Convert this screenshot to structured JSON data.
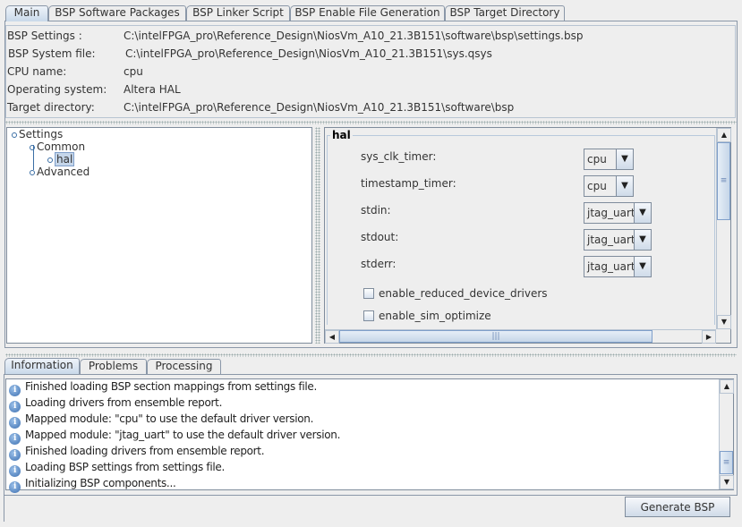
{
  "tabs": [
    "Main",
    "BSP Software Packages",
    "BSP Linker Script",
    "BSP Enable File Generation",
    "BSP Target Directory"
  ],
  "info": [
    {
      "label": "BSP Settings :",
      "value": "C:\\intelFPGA_pro\\Reference_Design\\NiosVm_A10_21.3B151\\software\\bsp\\settings.bsp"
    },
    {
      "label": "BSP System file:",
      "value": "C:\\intelFPGA_pro\\Reference_Design\\NiosVm_A10_21.3B151\\sys.qsys"
    },
    {
      "label": "CPU name:",
      "value": "cpu"
    },
    {
      "label": "Operating system:",
      "value": "Altera HAL"
    },
    {
      "label": "Target directory:",
      "value": "C:\\intelFPGA_pro\\Reference_Design\\NiosVm_A10_21.3B151\\software\\bsp"
    }
  ],
  "tree": {
    "root": "Settings",
    "common": "Common",
    "hal": "hal",
    "advanced": "Advanced"
  },
  "hal": {
    "title": "hal",
    "settings": [
      {
        "label": "sys_clk_timer:",
        "value": "cpu"
      },
      {
        "label": "timestamp_timer:",
        "value": "cpu"
      },
      {
        "label": "stdin:",
        "value": "jtag_uart"
      },
      {
        "label": "stdout:",
        "value": "jtag_uart"
      },
      {
        "label": "stderr:",
        "value": "jtag_uart"
      }
    ],
    "checkboxes": [
      {
        "label": "enable_reduced_device_drivers",
        "checked": false
      },
      {
        "label": "enable_sim_optimize",
        "checked": false
      }
    ]
  },
  "bottom_tabs": [
    "Information",
    "Problems",
    "Processing"
  ],
  "messages": [
    "Finished loading BSP section mappings from settings file.",
    "Loading drivers from ensemble report.",
    "Mapped module: \"cpu\" to use the default driver version.",
    "Mapped module: \"jtag_uart\" to use the default driver version.",
    "Finished loading drivers from ensemble report.",
    "Loading BSP settings from settings file.",
    "Initializing BSP components..."
  ],
  "generate_label": "Generate BSP"
}
